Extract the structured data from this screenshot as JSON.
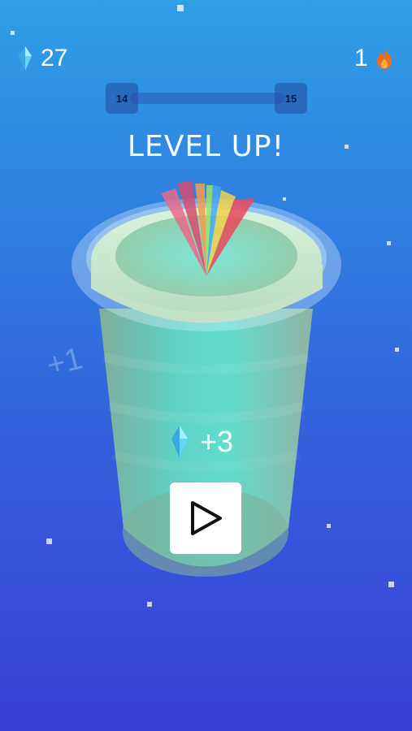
{
  "hud": {
    "gems": "27",
    "streak": "1"
  },
  "progress": {
    "current_level": "14",
    "next_level": "15",
    "fill": 0
  },
  "banner": "LEVEL UP!",
  "floating_text": "+1",
  "reward": {
    "amount": "+3"
  },
  "icons": {
    "gem": "gem-icon",
    "streak": "flame-icon",
    "play": "play-icon"
  },
  "colors": {
    "gem": "#5fd6f2",
    "flame": "#f26a1e",
    "cup": "#6fd8c8"
  }
}
